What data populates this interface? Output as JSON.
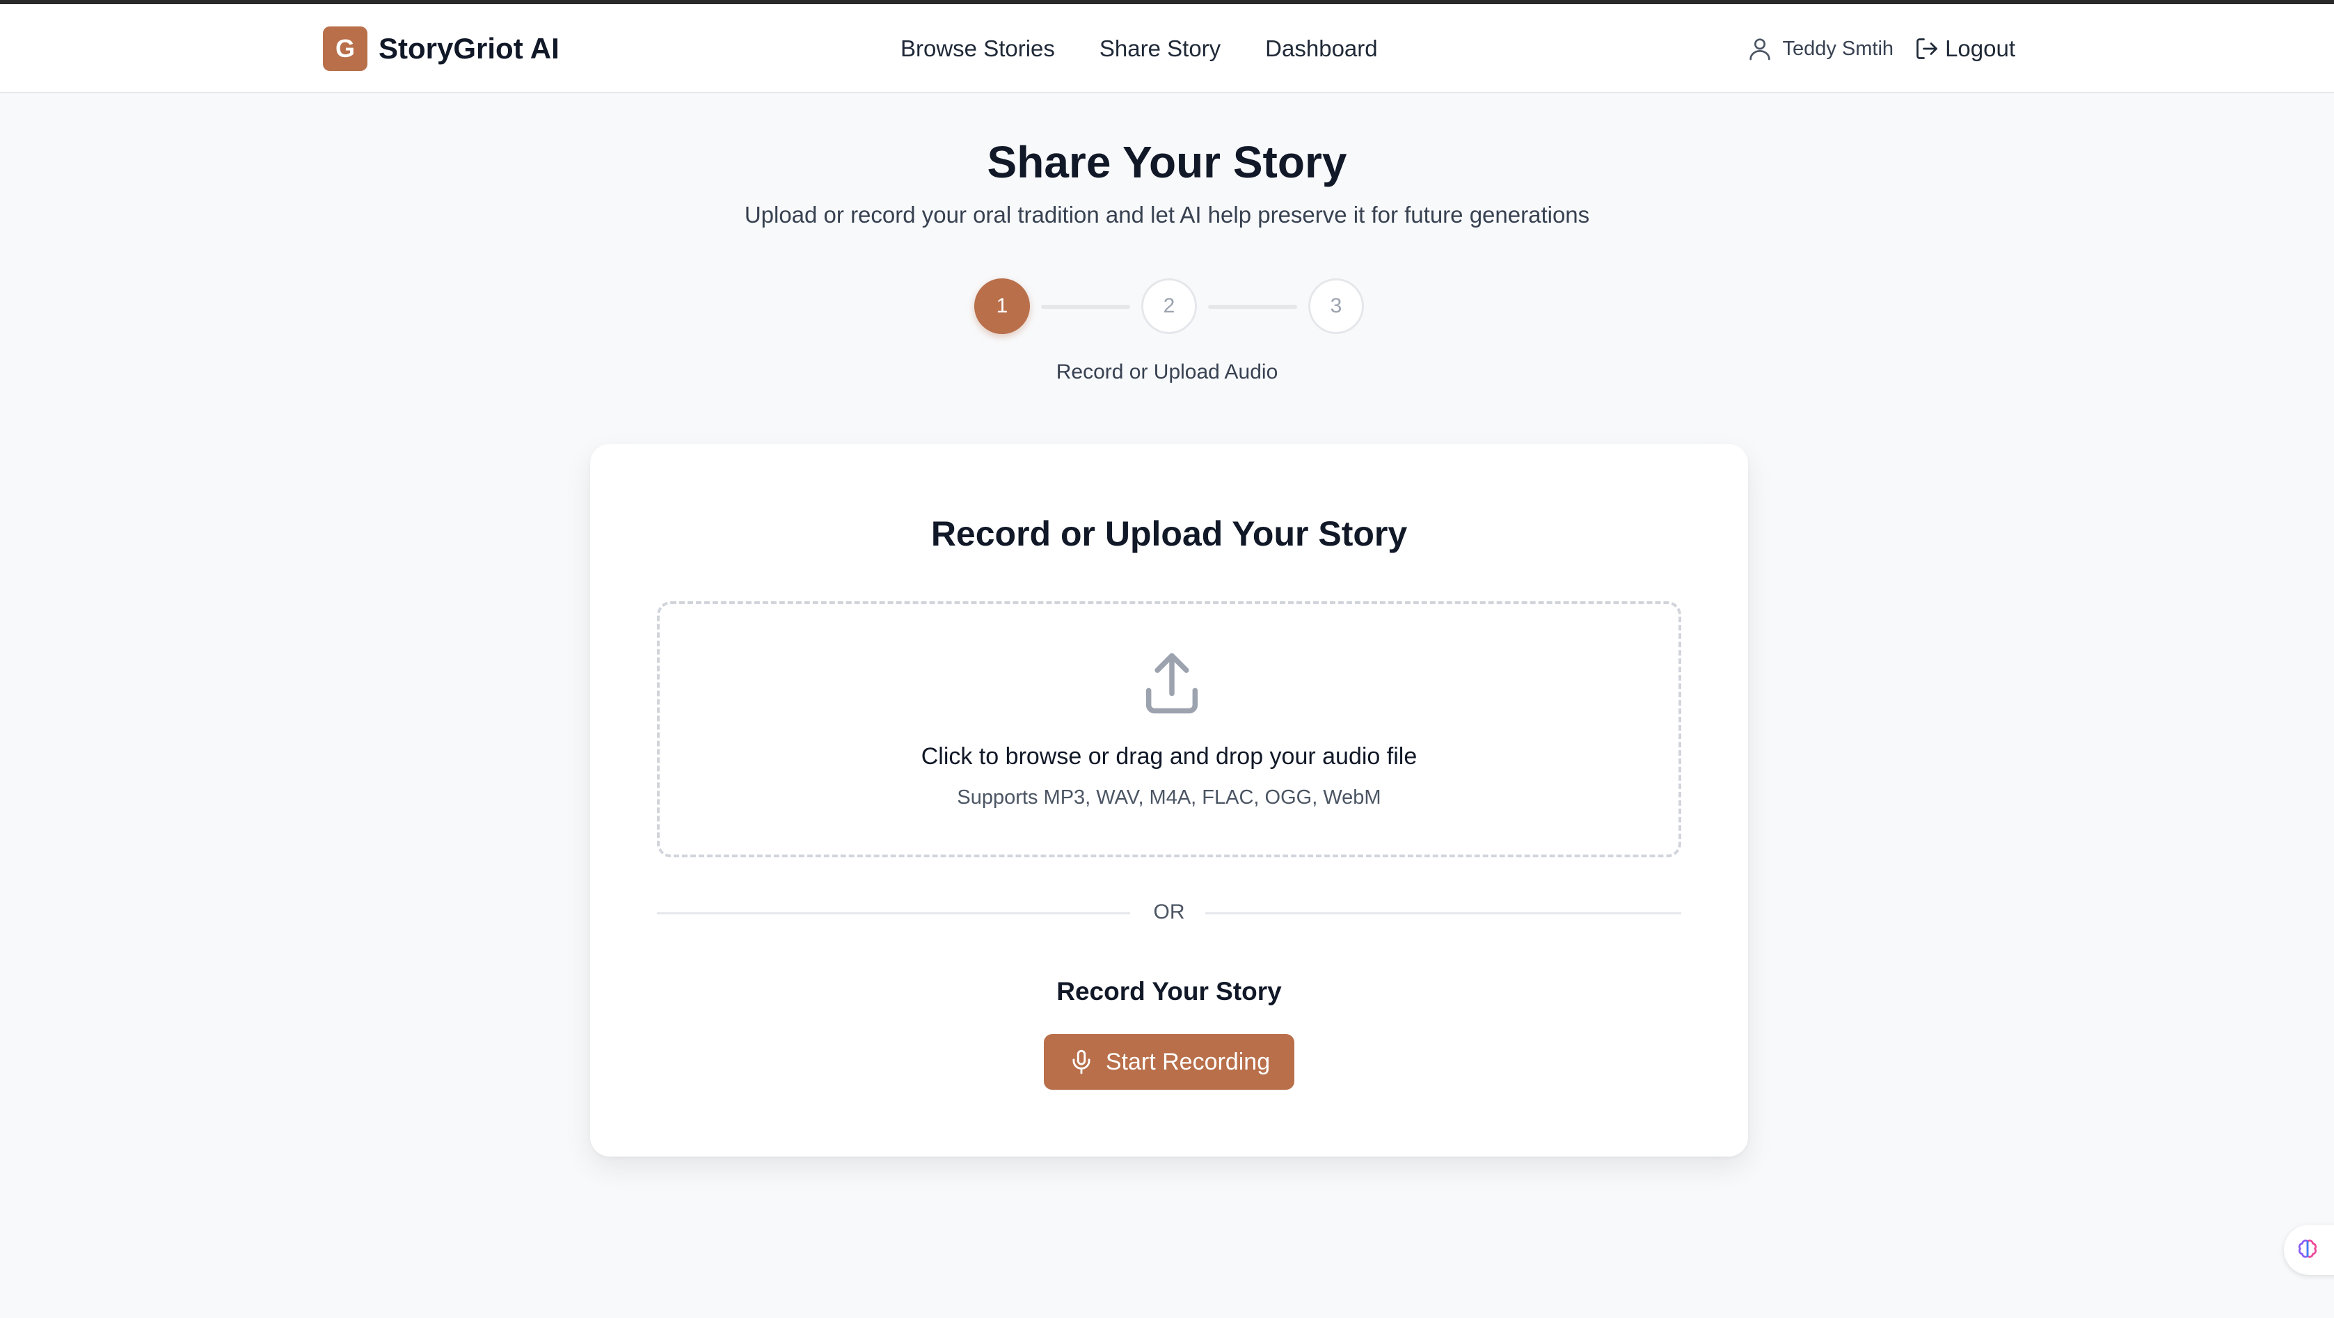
{
  "app": {
    "logo_letter": "G",
    "name": "StoryGriot AI",
    "brand_color": "#b86f4a"
  },
  "nav": {
    "items": [
      {
        "label": "Browse Stories"
      },
      {
        "label": "Share Story"
      },
      {
        "label": "Dashboard"
      }
    ]
  },
  "user": {
    "icon": "user-icon",
    "name": "Teddy Smtih",
    "logout_label": "Logout",
    "logout_icon": "logout-icon"
  },
  "page": {
    "title": "Share Your Story",
    "subtitle": "Upload or record your oral tradition and let AI help preserve it for future generations"
  },
  "stepper": {
    "steps": [
      "1",
      "2",
      "3"
    ],
    "current_step": 1,
    "current_label": "Record or Upload Audio"
  },
  "card": {
    "title": "Record or Upload Your Story",
    "dropzone": {
      "icon": "upload-icon",
      "main_text": "Click to browse or drag and drop your audio file",
      "sub_text": "Supports MP3, WAV, M4A, FLAC, OGG, WebM"
    },
    "divider_text": "OR",
    "record": {
      "title": "Record Your Story",
      "button_label": "Start Recording",
      "button_icon": "microphone-icon"
    }
  },
  "widget": {
    "icon": "brain-icon"
  }
}
